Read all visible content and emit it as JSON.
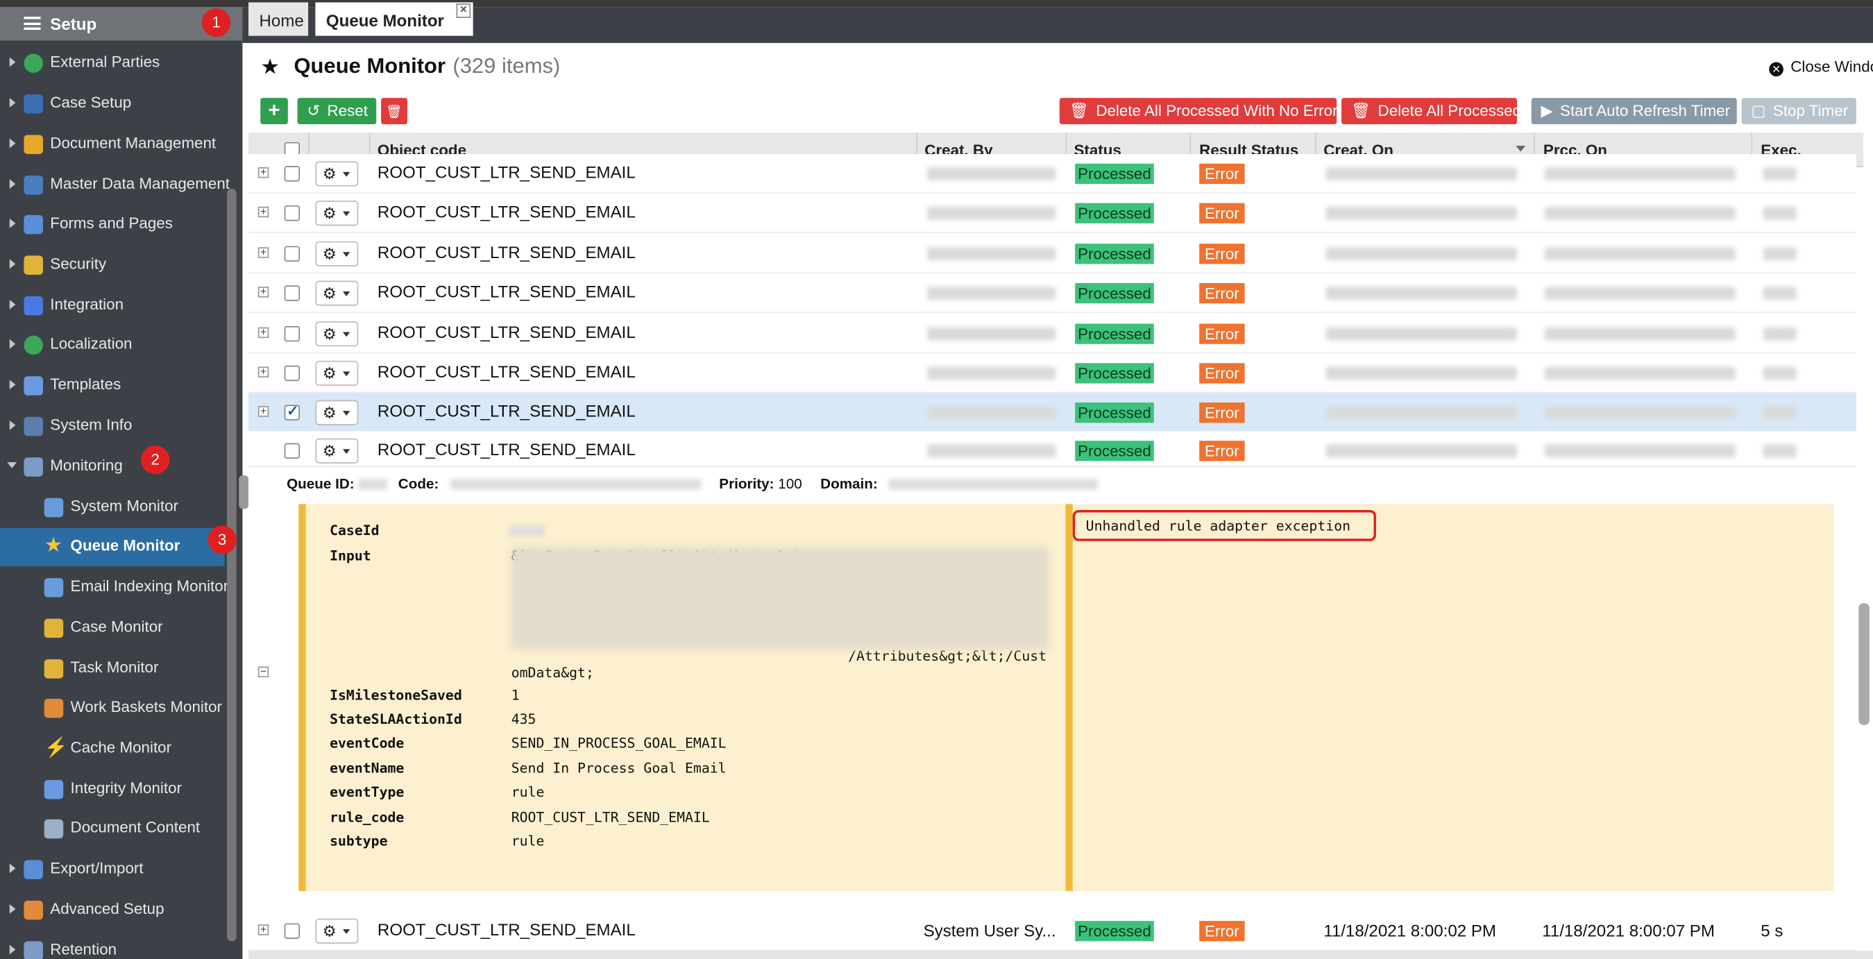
{
  "sidebar": {
    "title": "Setup",
    "items": [
      {
        "label": "External Parties",
        "icon": "globe-icon",
        "color": "#3aa858"
      },
      {
        "label": "Case Setup",
        "icon": "case-setup-icon",
        "color": "#3b6fb5"
      },
      {
        "label": "Document Management",
        "icon": "document-icon",
        "color": "#e6a82b"
      },
      {
        "label": "Master Data Management",
        "icon": "table-icon",
        "color": "#4a7dc0"
      },
      {
        "label": "Forms and Pages",
        "icon": "form-icon",
        "color": "#5b8ed8"
      },
      {
        "label": "Security",
        "icon": "lock-icon",
        "color": "#e0b43a"
      },
      {
        "label": "Integration",
        "icon": "plug-icon",
        "color": "#4a7ae0"
      },
      {
        "label": "Localization",
        "icon": "globe-icon",
        "color": "#3aa858"
      },
      {
        "label": "Templates",
        "icon": "template-icon",
        "color": "#6a9be0"
      },
      {
        "label": "System Info",
        "icon": "monitor-icon",
        "color": "#5a7fb0"
      },
      {
        "label": "Monitoring",
        "icon": "monitor-icon",
        "color": "#7c9cc8"
      },
      {
        "label": "System Monitor",
        "icon": "grid-icon",
        "color": "#6a9be0"
      },
      {
        "label": "Queue Monitor",
        "icon": "star-icon",
        "color": "#f5c242"
      },
      {
        "label": "Email Indexing Monitor",
        "icon": "email-icon",
        "color": "#6a9be0"
      },
      {
        "label": "Case Monitor",
        "icon": "case-monitor-icon",
        "color": "#e0b43a"
      },
      {
        "label": "Task Monitor",
        "icon": "task-monitor-icon",
        "color": "#e0b43a"
      },
      {
        "label": "Work Baskets Monitor",
        "icon": "user-icon",
        "color": "#e08a3a"
      },
      {
        "label": "Cache Monitor",
        "icon": "lightning-icon",
        "color": "#f5c242"
      },
      {
        "label": "Integrity Monitor",
        "icon": "list-icon",
        "color": "#6a9be0"
      },
      {
        "label": "Document Content",
        "icon": "document-content-icon",
        "color": "#9ab0c8"
      },
      {
        "label": "Export/Import",
        "icon": "disk-icon",
        "color": "#5b8ed8"
      },
      {
        "label": "Advanced Setup",
        "icon": "wrench-icon",
        "color": "#e08a3a"
      },
      {
        "label": "Retention",
        "icon": "retention-icon",
        "color": "#7c9cc8"
      }
    ],
    "badges": [
      "1",
      "2",
      "3"
    ]
  },
  "tabs": {
    "home": "Home",
    "queue_monitor": "Queue Monitor",
    "close": "×"
  },
  "page": {
    "title": "Queue Monitor",
    "count": "(329 items)",
    "close_window": "Close Windo"
  },
  "toolbar": {
    "add": "+",
    "reset": "Reset",
    "delete": "🗑",
    "delete_no_errors": "Delete All Processed With No Errors",
    "delete_all": "Delete All Processed",
    "start_timer": "Start Auto Refresh Timer",
    "stop_timer": "Stop Timer"
  },
  "grid": {
    "columns": [
      "Object code",
      "Creat. By",
      "Status",
      "Result Status",
      "Creat. On",
      "Prcc. On",
      "Exec."
    ],
    "rows": [
      {
        "object_code": "ROOT_CUST_LTR_SEND_EMAIL",
        "status": "Processed",
        "result": "Error",
        "selected": false
      },
      {
        "object_code": "ROOT_CUST_LTR_SEND_EMAIL",
        "status": "Processed",
        "result": "Error",
        "selected": false
      },
      {
        "object_code": "ROOT_CUST_LTR_SEND_EMAIL",
        "status": "Processed",
        "result": "Error",
        "selected": false
      },
      {
        "object_code": "ROOT_CUST_LTR_SEND_EMAIL",
        "status": "Processed",
        "result": "Error",
        "selected": false
      },
      {
        "object_code": "ROOT_CUST_LTR_SEND_EMAIL",
        "status": "Processed",
        "result": "Error",
        "selected": false
      },
      {
        "object_code": "ROOT_CUST_LTR_SEND_EMAIL",
        "status": "Processed",
        "result": "Error",
        "selected": false
      },
      {
        "object_code": "ROOT_CUST_LTR_SEND_EMAIL",
        "status": "Processed",
        "result": "Error",
        "selected": true
      },
      {
        "object_code": "ROOT_CUST_LTR_SEND_EMAIL",
        "status": "Processed",
        "result": "Error",
        "selected": false
      }
    ],
    "last_row": {
      "object_code": "ROOT_CUST_LTR_SEND_EMAIL",
      "created_by": "System User Sy...",
      "status": "Processed",
      "result": "Error",
      "created_on": "11/18/2021 8:00:02 PM",
      "processed_on": "11/18/2021 8:00:07 PM",
      "exec": "5 s"
    }
  },
  "detail": {
    "queue_id_label": "Queue ID:",
    "code_label": "Code:",
    "priority_label": "Priority:",
    "priority_value": "100",
    "domain_label": "Domain:",
    "fields": [
      {
        "key": "CaseId",
        "value": ""
      },
      {
        "key": "Input",
        "value": "&lt;CustomData&gt;&lt;Attributes&gt;"
      },
      {
        "key": "",
        "value": "/Attributes&gt;&lt;/Cust"
      },
      {
        "key": "",
        "value": "omData&gt;"
      },
      {
        "key": "IsMilestoneSaved",
        "value": "1"
      },
      {
        "key": "StateSLAActionId",
        "value": "435"
      },
      {
        "key": "eventCode",
        "value": "SEND_IN_PROCESS_GOAL_EMAIL"
      },
      {
        "key": "eventName",
        "value": "Send In Process Goal Email"
      },
      {
        "key": "eventType",
        "value": "rule"
      },
      {
        "key": "rule_code",
        "value": "ROOT_CUST_LTR_SEND_EMAIL"
      },
      {
        "key": "subtype",
        "value": "rule"
      }
    ],
    "error_message": "Unhandled rule adapter exception"
  }
}
